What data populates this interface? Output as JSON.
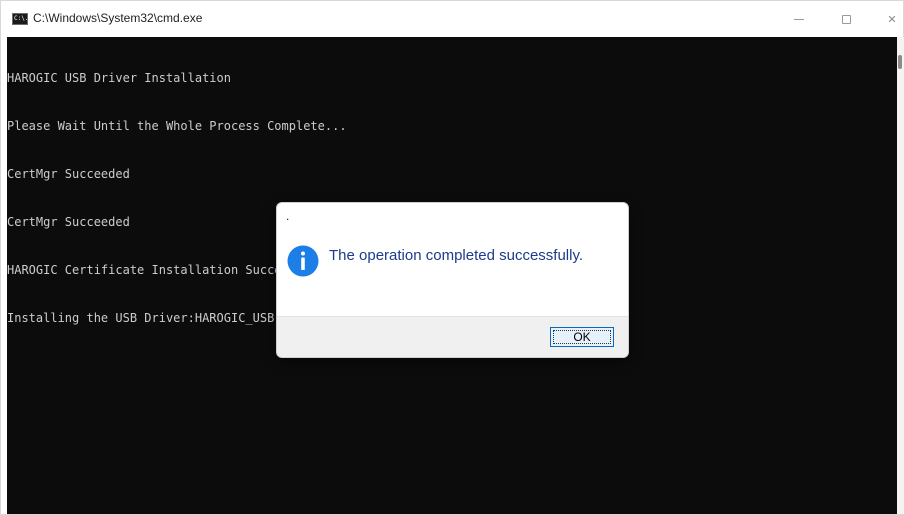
{
  "window": {
    "title": "C:\\Windows\\System32\\cmd.exe",
    "icon": "cmd-icon",
    "icon_text": "C:\\.",
    "controls": {
      "minimize_icon": "minimize-icon",
      "maximize_icon": "maximize-icon",
      "close_glyph": "✕"
    }
  },
  "console": {
    "background": "#0c0c0c",
    "foreground": "#cccccc",
    "lines": [
      "HAROGIC USB Driver Installation",
      "Please Wait Until the Whole Process Complete...",
      "CertMgr Succeeded",
      "CertMgr Succeeded",
      "HAROGIC Certificate Installation Succeeded",
      "Installing the USB Driver:HAROGIC_USB"
    ]
  },
  "dialog": {
    "title": ".",
    "icon": "info-icon",
    "icon_color": "#1c7ee6",
    "message": "The operation completed successfully.",
    "ok_label": "OK"
  }
}
